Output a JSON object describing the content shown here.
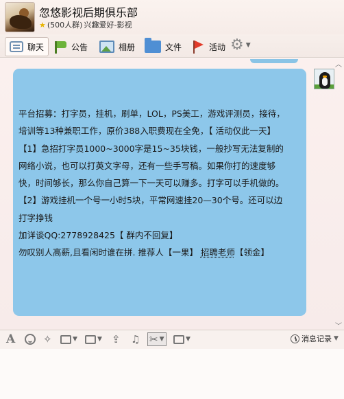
{
  "header": {
    "title": "忽悠影视后期俱乐部",
    "member_count": "(500人群)",
    "category": "兴趣爱好-影视"
  },
  "tabs": [
    {
      "label": "聊天",
      "icon": "chat-bubble-icon",
      "active": true
    },
    {
      "label": "公告",
      "icon": "announcement-flag-icon",
      "active": false
    },
    {
      "label": "相册",
      "icon": "photo-album-icon",
      "active": false
    },
    {
      "label": "文件",
      "icon": "folder-icon",
      "active": false
    },
    {
      "label": "活动",
      "icon": "activity-flag-icon",
      "active": false
    }
  ],
  "message": {
    "lines": [
      "平台招募：打字员，挂机，刷单，LOL，PS美工，游戏评测员，接待，",
      "培训等13种兼职工作，原价388入职费现在全免，【 活动仅此一天】",
      "【1】急招打字员1000~3000字是15~35块钱，一般抄写无法复制的",
      "网络小说，也可以打英文字母，还有一些手写稿。如果你打的速度够",
      "快，时间够长，那么你自己算一下一天可以赚多。打字可以手机做的。",
      "【2】游戏挂机一个号一小时5块，平常网速挂20—30个号。还可以边",
      "打字挣钱",
      " 加详谈QQ:2778928425【 群内不回复】"
    ],
    "last_line_prefix": "勿叹别人高薪,且看闲时谁在拼. 推荐人【一果】 ",
    "last_line_link": "招聘老师",
    "last_line_suffix": "【领金】"
  },
  "toolbar": {
    "history_label": "消息记录"
  },
  "colors": {
    "bubble": "#8dc7ea",
    "background": "#fbf0ee"
  }
}
